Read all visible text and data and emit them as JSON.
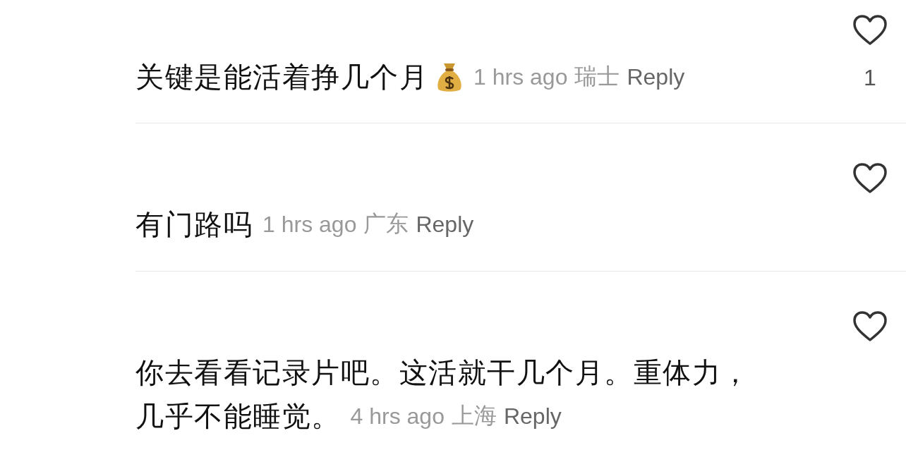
{
  "comments": [
    {
      "lines": [
        "关键是能活着挣几个月"
      ],
      "time": "1 hrs ago",
      "location": "瑞士",
      "reply": "Reply",
      "likes": "1"
    },
    {
      "lines": [
        "有门路吗"
      ],
      "time": "1 hrs ago",
      "location": "广东",
      "reply": "Reply"
    },
    {
      "lines": [
        "你去看看记录片吧。这活就干几个月。重体力，",
        "几乎不能睡觉。"
      ],
      "time": "4 hrs ago",
      "location": "上海",
      "reply": "Reply"
    }
  ]
}
